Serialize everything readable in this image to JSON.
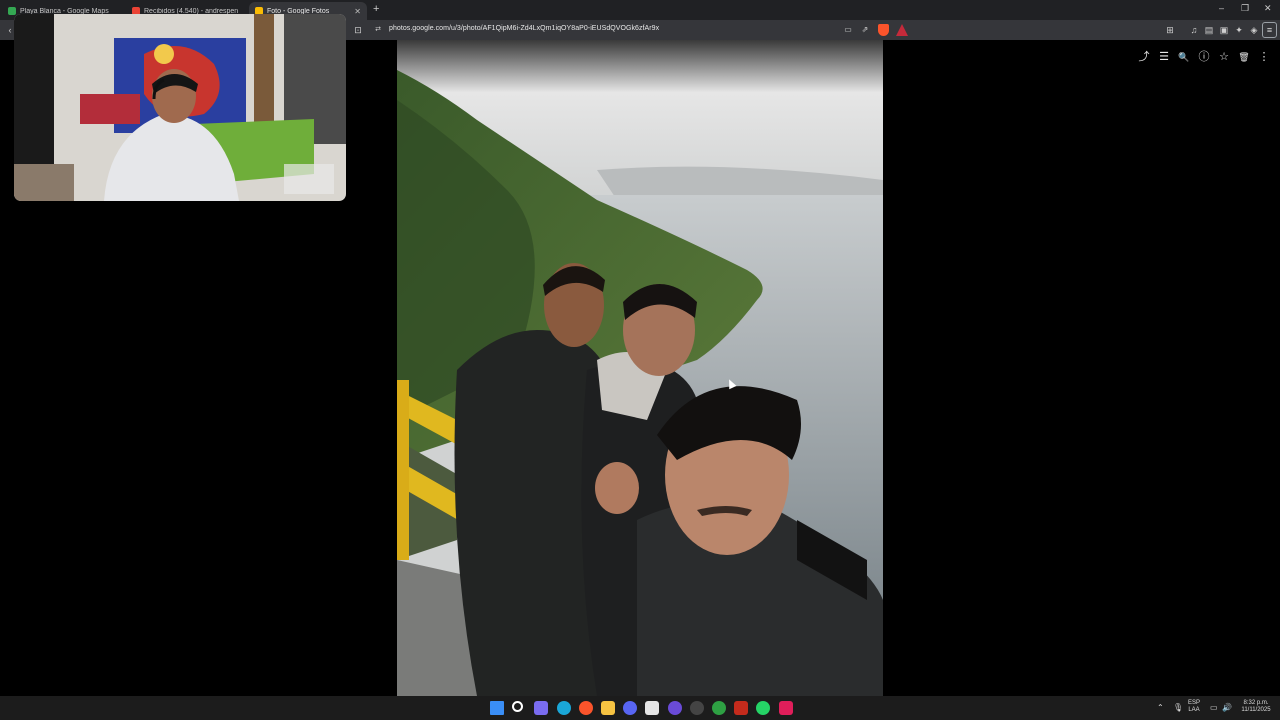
{
  "browser": {
    "tabs": [
      {
        "label": "Playa Blanca - Google Maps",
        "favicon_color": "#34a853",
        "active": false
      },
      {
        "label": "Recibidos (4.540) - andrespenaloza...",
        "favicon_color": "#ea4335",
        "active": false
      },
      {
        "label": "Foto - Google Fotos",
        "favicon_color": "#fbbc04",
        "active": true
      }
    ],
    "new_tab_glyph": "+",
    "window_controls": {
      "minimize": "–",
      "restore": "❐",
      "close": "✕"
    },
    "url": "photos.google.com/u/3/photo/AF1QipM6i-Zd4LxQm1iqOY8aP0-iEUSdQVOGk6zfAr9x",
    "icons": [
      "back-icon",
      "bookmark-icon",
      "site-info-icon",
      "cast-icon",
      "share-icon",
      "brave-shields-icon",
      "brave-rewards-icon",
      "media-icon",
      "sidebar-icon",
      "wallet-icon",
      "extensions-icon",
      "vpn-icon",
      "menu-icon"
    ]
  },
  "photo_viewer": {
    "actions": [
      {
        "name": "share-icon",
        "glyph": "⤴"
      },
      {
        "name": "edit-icon",
        "glyph": "☰"
      },
      {
        "name": "zoom-icon",
        "glyph": "🔍"
      },
      {
        "name": "info-icon",
        "glyph": "ⓘ"
      },
      {
        "name": "favorite-icon",
        "glyph": "☆"
      },
      {
        "name": "delete-icon",
        "glyph": "🗑"
      },
      {
        "name": "more-options-icon",
        "glyph": "⋮"
      }
    ]
  },
  "taskbar": {
    "apps": [
      {
        "name": "windows-start-icon",
        "color": "#3a8ef6"
      },
      {
        "name": "search-icon",
        "color": "#ffffff"
      },
      {
        "name": "copilot-icon",
        "color": "#7a6cf0"
      },
      {
        "name": "edge-icon",
        "color": "#1aa7d8"
      },
      {
        "name": "brave-icon",
        "color": "#fb542b"
      },
      {
        "name": "file-explorer-icon",
        "color": "#f6c342"
      },
      {
        "name": "discord-icon",
        "color": "#5865f2"
      },
      {
        "name": "store-icon",
        "color": "#e5e5e5"
      },
      {
        "name": "cortana-icon",
        "color": "#6a4bd8"
      },
      {
        "name": "obs-icon",
        "color": "#444444"
      },
      {
        "name": "app-icon",
        "color": "#2ea043"
      },
      {
        "name": "calendar-icon",
        "color": "#c42b1c"
      },
      {
        "name": "whatsapp-icon",
        "color": "#25d366"
      },
      {
        "name": "slack-icon",
        "color": "#e01e5a"
      }
    ],
    "language": "ESP",
    "language_variant": "LAA",
    "time": "8:32 p.m.",
    "date": "11/11/2025"
  }
}
